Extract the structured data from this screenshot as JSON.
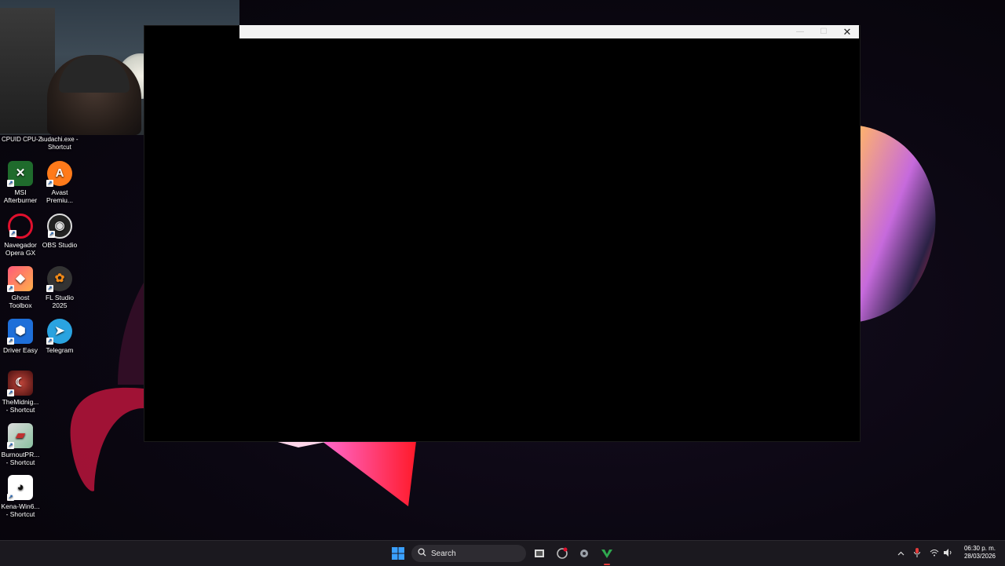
{
  "webcam": {
    "label": "webcam-overlay"
  },
  "top_labels": {
    "left": "CPUID CPU-Z",
    "right_line1": "sudachi.exe -",
    "right_line2": "Shortcut"
  },
  "desktop_icons": [
    {
      "label_1": "MSI",
      "label_2": "Afterburner",
      "icon": "afterburner-icon",
      "color": "#2e8b3e"
    },
    {
      "label_1": "Avast",
      "label_2": "Premiu...",
      "icon": "avast-icon",
      "color": "#ff7a1a"
    },
    {
      "label_1": "Navegador",
      "label_2": "Opera GX",
      "icon": "opera-gx-icon",
      "color": "#e0102d"
    },
    {
      "label_1": "OBS Studio",
      "label_2": "",
      "icon": "obs-icon",
      "color": "#2b2b2b"
    },
    {
      "label_1": "Ghost",
      "label_2": "Toolbox",
      "icon": "ghost-toolbox-icon",
      "color": "#f05a6a"
    },
    {
      "label_1": "FL Studio",
      "label_2": "2025",
      "icon": "fl-studio-icon",
      "color": "#f08a1a"
    },
    {
      "label_1": "Driver Easy",
      "label_2": "",
      "icon": "driver-easy-icon",
      "color": "#1e6fd9"
    },
    {
      "label_1": "Telegram",
      "label_2": "",
      "icon": "telegram-icon",
      "color": "#2aa3e0"
    },
    {
      "label_1": "TheMidnig...",
      "label_2": "- Shortcut",
      "icon": "midnight-icon",
      "color": "#8a2020"
    },
    {
      "label_1": "BurnoutPR...",
      "label_2": "- Shortcut",
      "icon": "burnout-icon",
      "color": "#c8c8c8"
    },
    {
      "label_1": "Kena-Win6...",
      "label_2": "- Shortcut",
      "icon": "kena-icon",
      "color": "#ffffff"
    }
  ],
  "window": {
    "close_label": "✕",
    "maximize_label": "☐",
    "minimize_label": "—"
  },
  "taskbar": {
    "search_placeholder": "Search",
    "start_icon": "windows-start-icon",
    "apps": [
      "task-view-icon",
      "opera-gx-taskbar-icon",
      "settings-icon",
      "vim-icon"
    ]
  },
  "tray": {
    "time": "06:30 p. m.",
    "date": "28/03/2026"
  }
}
